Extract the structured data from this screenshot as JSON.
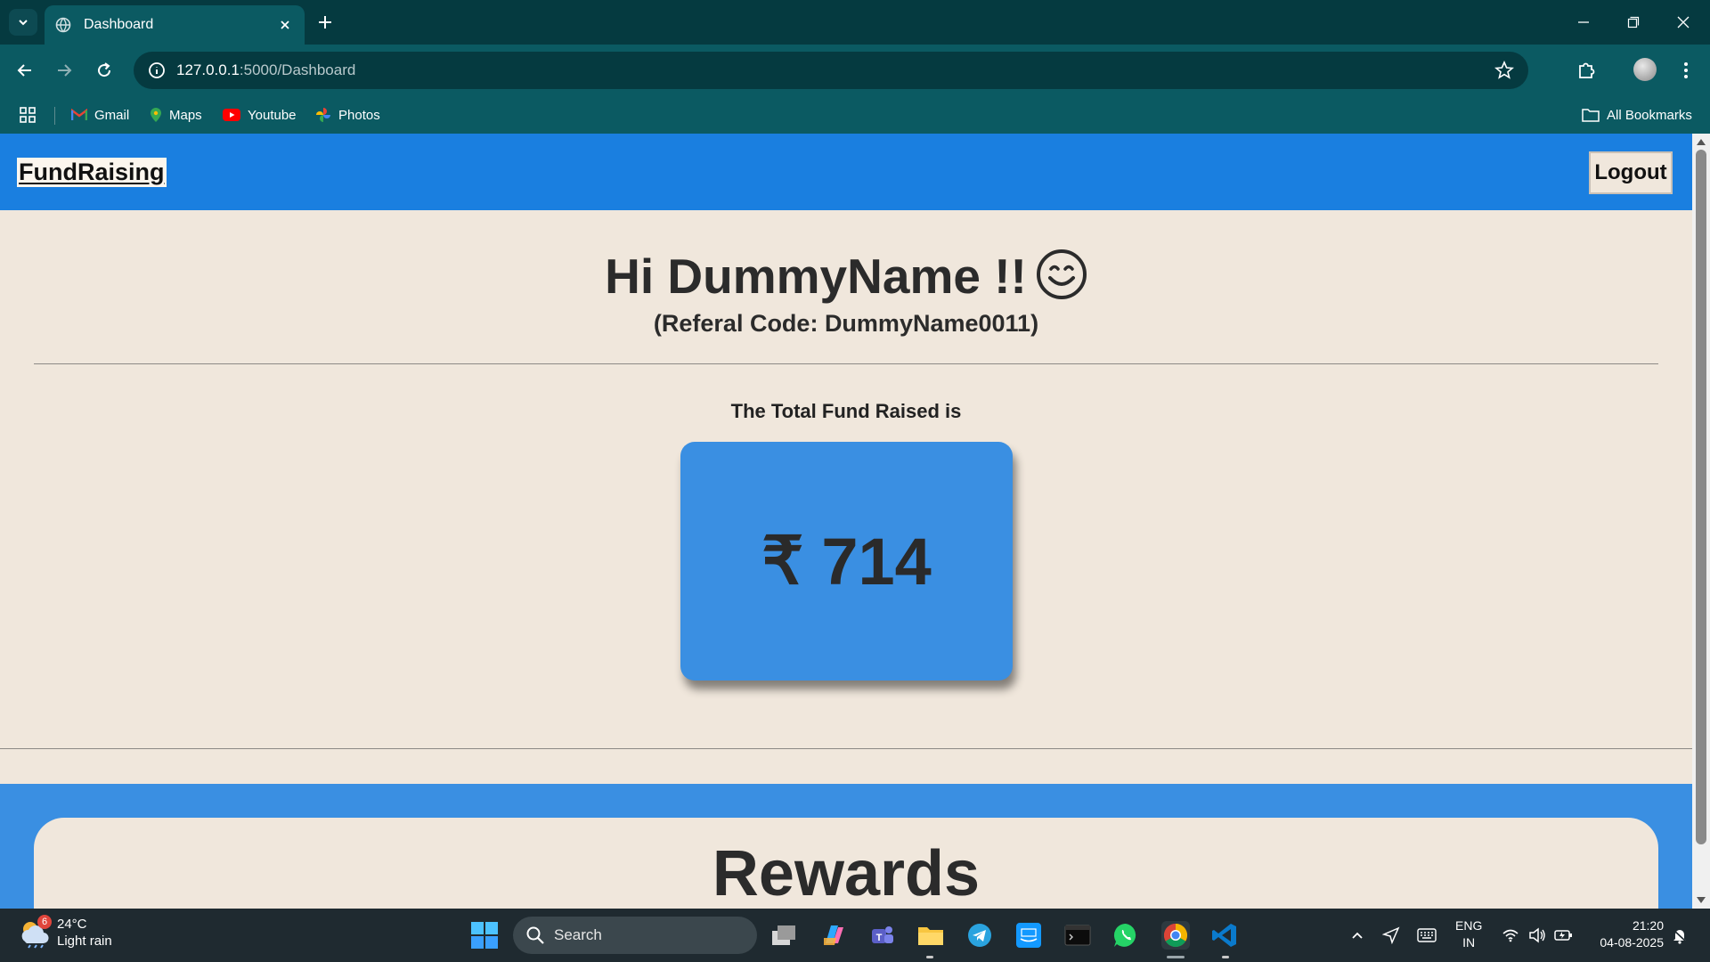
{
  "browser": {
    "tab_title": "Dashboard",
    "url_host": "127.0.0.1",
    "url_path": ":5000/Dashboard",
    "bookmarks": [
      "Gmail",
      "Maps",
      "Youtube",
      "Photos"
    ],
    "all_bookmarks_label": "All Bookmarks"
  },
  "page": {
    "brand": "FundRaising",
    "logout_label": "Logout",
    "greeting": "Hi DummyName !!",
    "referral": "(Referal Code: DummyName0011)",
    "fund_label": "The Total Fund Raised is",
    "currency_symbol": "₹",
    "fund_amount": "714",
    "rewards_title": "Rewards"
  },
  "taskbar": {
    "weather_badge": "6",
    "temperature": "24°C",
    "weather_desc": "Light rain",
    "search_placeholder": "Search",
    "language_top": "ENG",
    "language_bottom": "IN",
    "time": "21:20",
    "date": "04-08-2025"
  },
  "colors": {
    "navbar": "#1a7fe0",
    "card": "#3a8fe2",
    "page_bg": "#f0e7dc",
    "chrome_dark": "#053a40",
    "chrome_toolbar": "#0b5a62"
  }
}
